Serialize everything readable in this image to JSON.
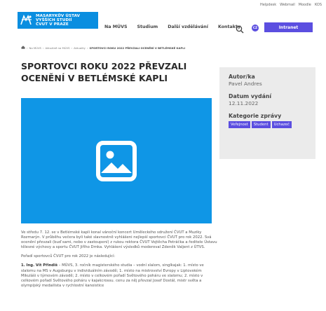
{
  "header": {
    "logo_lines": [
      "MASARYKŮV ÚSTAV",
      "VYŠŠÍCH STUDIÍ",
      "ČVUT V PRAZE"
    ],
    "top_links": [
      "Helpdesk",
      "Webmail",
      "Moodle",
      "KOS"
    ],
    "nav": [
      "Na MÚVS",
      "Studium",
      "Další vzdělávání",
      "Kontakty"
    ],
    "lang": "CZ",
    "intranet_label": "Intranet"
  },
  "breadcrumb": {
    "items": [
      "Na MÚVS",
      "Aktuálně na MÚVS",
      "Aktuality"
    ],
    "current": "SPORTOVCI ROKU 2022 PŘEVZALI OCENĚNÍ V BETLÉMSKÉ KAPLI"
  },
  "article": {
    "title": "SPORTOVCI ROKU 2022 PŘEVZALI OCENĚNÍ V BETLÉMSKÉ KAPLI",
    "paragraph1": "Ve středu 7. 12. se v Betlémské kapli konal vánoční koncert Uměleckého sdružení ČVUT a Muziky Rozmarýn. V průběhu večera byli také slavnostně vyhlášeni nejlepší sportovci ČVUT pro rok 2022. Svá ocenění převzali (buď sami, nebo v zastoupení) z rukou rektora ČVUT Vojtěcha Petráčka a ředitele Ústavu tělesné výchovy a sportu ČVUT Jiřího Drnka. Vyhlášení výsledků moderoval Zdeněk Valjent z ÚTVS.",
    "paragraph2": "Pořadí sportovců ČVUT pro rok 2022 je následující:",
    "list_item_lead": "1. Ing. Vít Přindiš",
    "list_item_text": " – MÚVS, 3. ročník magisterského studia – vodní slalom, singlkajak: 1. místo ve slalomu na MS v Augsburgu v individuálním závodě; 1. místo na mistrovství Evropy v Liptovském Mikuláši v týmovém závodě; 2. místo v celkovém pořadí Světového poháru ve slalomu; 2. místo v celkovém pořadí Světového poháru v kajakcrossu. cenu za něj převzal Josef Dostál, mistr světa a olympijský medailista v rychlostní kanoistice"
  },
  "sidebar": {
    "author_label": "Autor/ka",
    "author_value": "Pavel Andres",
    "date_label": "Datum vydání",
    "date_value": "12.11.2022",
    "category_label": "Kategorie zprávy",
    "tags": [
      "Veřejnost",
      "Student",
      "Uchazeč"
    ]
  },
  "icons": {
    "home": "home-icon",
    "search": "search-icon",
    "image": "image-placeholder-icon"
  },
  "colors": {
    "brand_blue": "#0a8ee0",
    "accent_purple": "#5b4ee0",
    "sidebar_bg": "#ebebeb"
  }
}
